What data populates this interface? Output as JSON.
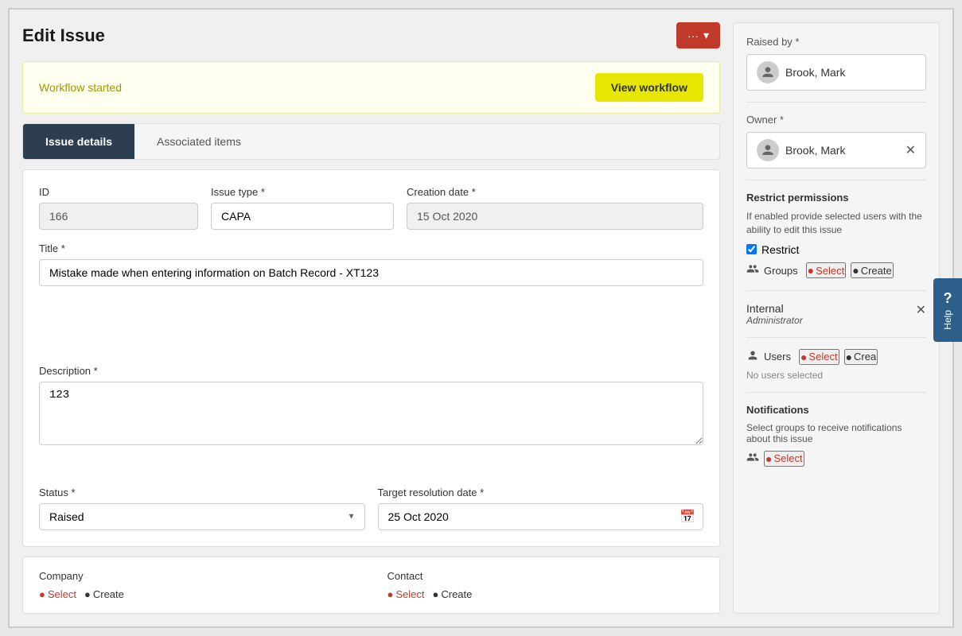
{
  "page": {
    "title": "Edit Issue"
  },
  "header": {
    "more_btn_label": "···",
    "dropdown_icon": "▾"
  },
  "workflow": {
    "text": "Workflow started",
    "btn_label": "View workflow"
  },
  "tabs": [
    {
      "label": "Issue details",
      "active": true
    },
    {
      "label": "Associated items",
      "active": false
    }
  ],
  "form": {
    "id_label": "ID",
    "id_value": "166",
    "issue_type_label": "Issue type *",
    "issue_type_value": "CAPA",
    "creation_date_label": "Creation date *",
    "creation_date_value": "15 Oct 2020",
    "title_label": "Title *",
    "title_value": "Mistake made when entering information on Batch Record - XT123",
    "description_label": "Description *",
    "description_value": "123",
    "status_label": "Status *",
    "status_value": "Raised",
    "target_date_label": "Target resolution date *",
    "target_date_value": "25 Oct 2020"
  },
  "bottom": {
    "company_label": "Company",
    "company_select": "Select",
    "company_create": "Create",
    "contact_label": "Contact",
    "contact_select": "Select",
    "contact_create": "Create"
  },
  "right_panel": {
    "raised_by_label": "Raised by *",
    "raised_by_name": "Brook, Mark",
    "owner_label": "Owner *",
    "owner_name": "Brook, Mark",
    "restrict_title": "Restrict permissions",
    "restrict_desc": "If enabled provide selected users with the ability to edit this issue",
    "restrict_checkbox_label": "Restrict",
    "groups_label": "Groups",
    "groups_select": "Select",
    "groups_create": "Create",
    "internal_name": "Internal",
    "internal_role": "Administrator",
    "users_label": "Users",
    "users_select": "Select",
    "users_create": "Crea",
    "no_users_text": "No users selected",
    "notifications_title": "Notifications",
    "notifications_desc": "Select groups to receive notifications about this issue",
    "notifications_select": "Select"
  },
  "help": {
    "icon": "?",
    "label": "Help"
  },
  "colors": {
    "accent_red": "#c0392b",
    "dark_tab": "#2c3e50",
    "yellow_banner_bg": "#fffff0",
    "yellow_btn": "#e6e600",
    "help_blue": "#2c5f8a"
  }
}
